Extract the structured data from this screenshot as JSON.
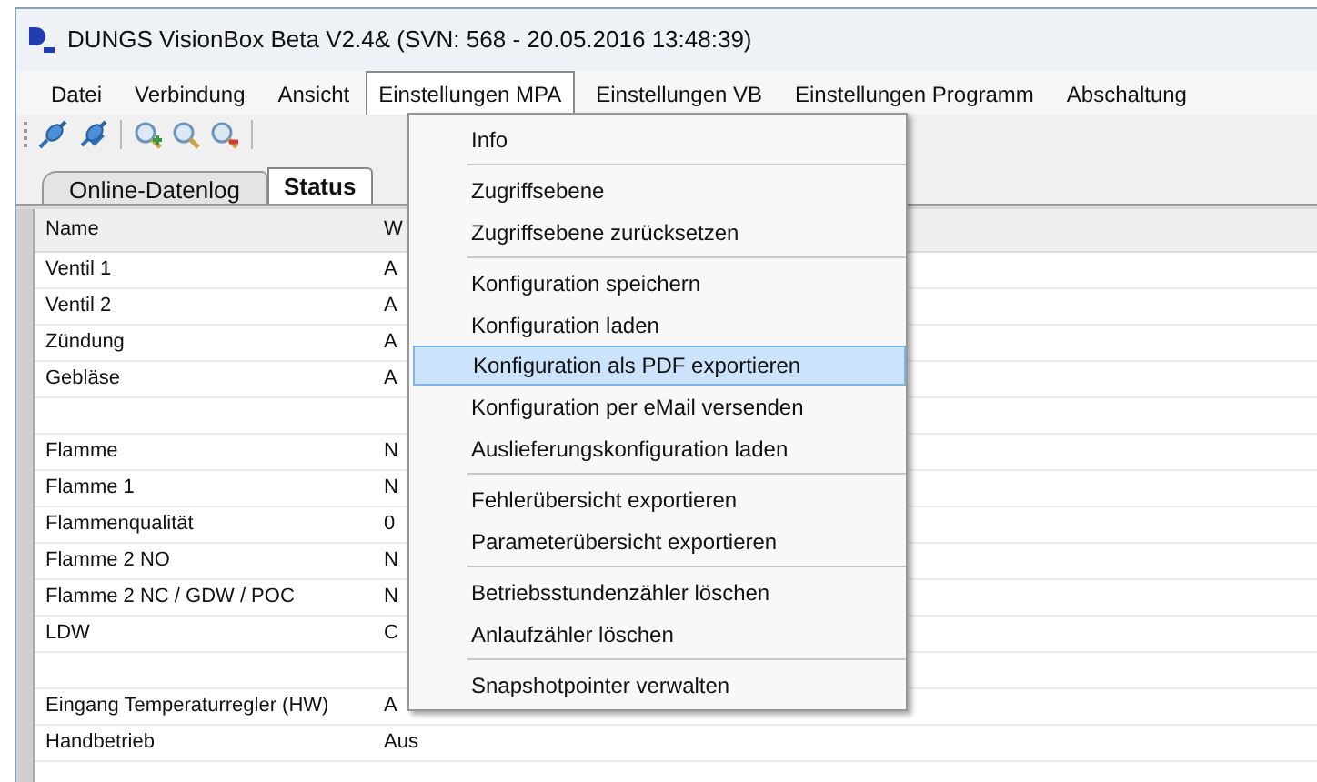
{
  "window": {
    "title": "DUNGS VisionBox Beta V2.4& (SVN: 568 - 20.05.2016 13:48:39)"
  },
  "menu_bar": [
    {
      "label": "Datei",
      "selected": false
    },
    {
      "label": "Verbindung",
      "selected": false
    },
    {
      "label": "Ansicht",
      "selected": false
    },
    {
      "label": "Einstellungen MPA",
      "selected": true
    },
    {
      "label": "Einstellungen VB",
      "selected": false
    },
    {
      "label": "Einstellungen Programm",
      "selected": false
    },
    {
      "label": "Abschaltung",
      "selected": false
    }
  ],
  "tabs": [
    {
      "label": "Online-Datenlog",
      "selected": false
    },
    {
      "label": "Status",
      "selected": true
    }
  ],
  "table": {
    "columns": [
      "Name",
      "W"
    ],
    "rows": [
      [
        "Ventil 1",
        "A"
      ],
      [
        "Ventil 2",
        "A"
      ],
      [
        "Zündung",
        "A"
      ],
      [
        "Gebläse",
        "A"
      ],
      [
        "",
        ""
      ],
      [
        "Flamme",
        "N"
      ],
      [
        "Flamme 1",
        "N"
      ],
      [
        "Flammenqualität",
        "0"
      ],
      [
        "Flamme 2 NO",
        "N"
      ],
      [
        "Flamme 2 NC / GDW / POC",
        "N"
      ],
      [
        "LDW",
        "C"
      ],
      [
        "",
        ""
      ],
      [
        "Eingang Temperaturregler (HW)",
        "A"
      ],
      [
        "Handbetrieb",
        "Aus"
      ]
    ]
  },
  "dropdown_menu": {
    "groups": [
      [
        {
          "label": "Info",
          "selected": false
        }
      ],
      [
        {
          "label": "Zugriffsebene",
          "selected": false
        },
        {
          "label": "Zugriffsebene zurücksetzen",
          "selected": false
        }
      ],
      [
        {
          "label": "Konfiguration speichern",
          "selected": false
        },
        {
          "label": "Konfiguration laden",
          "selected": false
        },
        {
          "label": "Konfiguration als PDF exportieren",
          "selected": true
        },
        {
          "label": "Konfiguration per eMail versenden",
          "selected": false
        },
        {
          "label": "Auslieferungskonfiguration laden",
          "selected": false
        }
      ],
      [
        {
          "label": "Fehlerübersicht exportieren",
          "selected": false
        },
        {
          "label": "Parameterübersicht exportieren",
          "selected": false
        }
      ],
      [
        {
          "label": "Betriebsstundenzähler löschen",
          "selected": false
        },
        {
          "label": "Anlaufzähler löschen",
          "selected": false
        }
      ],
      [
        {
          "label": "Snapshotpointer verwalten",
          "selected": false
        }
      ]
    ]
  }
}
